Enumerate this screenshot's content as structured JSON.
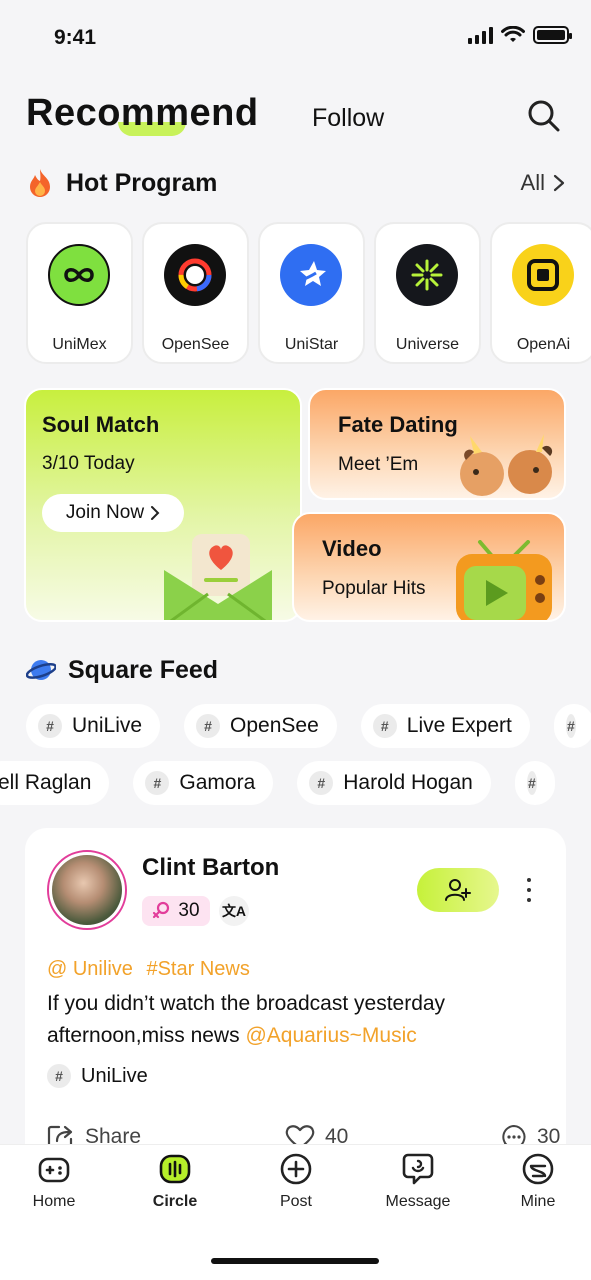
{
  "status_bar": {
    "time": "9:41"
  },
  "header": {
    "tab_recommend": "Recommend",
    "tab_follow": "Follow"
  },
  "hot_program": {
    "title": "Hot Program",
    "all_label": "All",
    "items": [
      {
        "label": "UniMex",
        "icon": "infinity-icon",
        "color": "#7fe03f"
      },
      {
        "label": "OpenSee",
        "icon": "ring-icon",
        "color": "#111111"
      },
      {
        "label": "UniStar",
        "icon": "star-icon",
        "color": "#2f6ef2"
      },
      {
        "label": "Universe",
        "icon": "asterisk-icon",
        "color": "#15171c"
      },
      {
        "label": "OpenAi",
        "icon": "square-icon",
        "color": "#f9d21a"
      }
    ]
  },
  "cards": {
    "soul_match": {
      "title": "Soul Match",
      "subtitle": "3/10 Today",
      "button": "Join Now"
    },
    "fate_dating": {
      "title": "Fate Dating",
      "subtitle": "Meet ’Em"
    },
    "video": {
      "title": "Video",
      "subtitle": "Popular Hits"
    }
  },
  "square_feed": {
    "title": "Square Feed",
    "row1": [
      "UniLive",
      "OpenSee",
      "Live Expert"
    ],
    "row2": [
      "ell Raglan",
      "Gamora",
      "Harold Hogan"
    ]
  },
  "post": {
    "author": "Clint Barton",
    "gender_count": "30",
    "translate_glyph": "文A",
    "mention1": "@ Unilive",
    "mention2": "#Star News",
    "text": "If you didn’t watch the broadcast yesterday afternoon,miss news ",
    "text_mention": "@Aquarius~Music",
    "tag": "UniLive",
    "share_label": "Share",
    "likes": "40",
    "comments": "30"
  },
  "nav": {
    "items": [
      {
        "label": "Home",
        "active": false
      },
      {
        "label": "Circle",
        "active": true
      },
      {
        "label": "Post",
        "active": false
      },
      {
        "label": "Message",
        "active": false
      },
      {
        "label": "Mine",
        "active": false
      }
    ]
  }
}
